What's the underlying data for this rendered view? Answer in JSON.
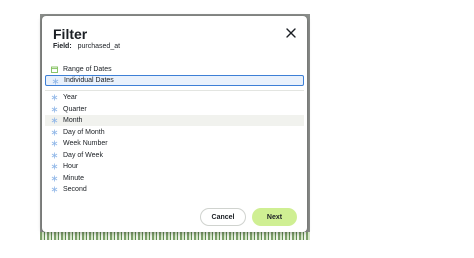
{
  "dialog": {
    "title": "Filter",
    "field_label": "Field:",
    "field_value": "purchased_at"
  },
  "options": [
    {
      "label": "Range of Dates",
      "icon": "calendar-icon"
    },
    {
      "label": "Individual Dates",
      "icon": "snowflake-icon",
      "selected": true
    }
  ],
  "units": [
    {
      "label": "Year",
      "icon": "snowflake-icon"
    },
    {
      "label": "Quarter",
      "icon": "snowflake-icon"
    },
    {
      "label": "Month",
      "icon": "snowflake-icon",
      "hovered": true
    },
    {
      "label": "Day of Month",
      "icon": "snowflake-icon"
    },
    {
      "label": "Week Number",
      "icon": "snowflake-icon"
    },
    {
      "label": "Day of Week",
      "icon": "snowflake-icon"
    },
    {
      "label": "Hour",
      "icon": "snowflake-icon"
    },
    {
      "label": "Minute",
      "icon": "snowflake-icon"
    },
    {
      "label": "Second",
      "icon": "snowflake-icon"
    }
  ],
  "buttons": {
    "cancel": "Cancel",
    "next": "Next"
  },
  "colors": {
    "accent_blue": "#3d7fd6",
    "next_green": "#cfef93",
    "icon_blue": "#8fb6e8",
    "calendar_green": "#7fbf5a"
  }
}
